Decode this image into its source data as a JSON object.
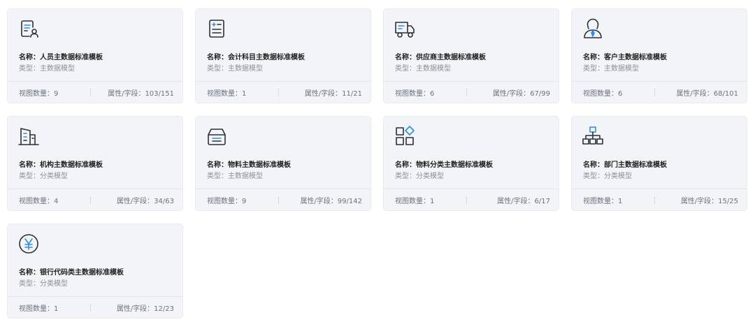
{
  "colors": {
    "icon_stroke": "#2b3036",
    "icon_accent": "#2d8cf0",
    "card_bg": "#f2f4f7"
  },
  "cards": [
    {
      "icon": "user-document-icon",
      "name": "名称：人员主数据标准模板",
      "type": "类型：主数据模型",
      "views": "视图数量：9",
      "fields": "属性/字段：103/151"
    },
    {
      "icon": "ledger-document-icon",
      "name": "名称：会计科目主数据标准模板",
      "type": "类型：主数据模型",
      "views": "视图数量：1",
      "fields": "属性/字段：11/21"
    },
    {
      "icon": "truck-icon",
      "name": "名称：供应商主数据标准模板",
      "type": "类型：主数据模型",
      "views": "视图数量：6",
      "fields": "属性/字段：67/99"
    },
    {
      "icon": "customer-icon",
      "name": "名称：客户主数据标准模板",
      "type": "类型：主数据模型",
      "views": "视图数量：6",
      "fields": "属性/字段：68/101"
    },
    {
      "icon": "building-icon",
      "name": "名称：机构主数据标准模板",
      "type": "类型：分类模型",
      "views": "视图数量：4",
      "fields": "属性/字段：34/63"
    },
    {
      "icon": "inbox-tray-icon",
      "name": "名称：物料主数据标准模板",
      "type": "类型：主数据模型",
      "views": "视图数量：9",
      "fields": "属性/字段：99/142"
    },
    {
      "icon": "category-shapes-icon",
      "name": "名称：物料分类主数据标准模板",
      "type": "类型：分类模型",
      "views": "视图数量：1",
      "fields": "属性/字段：6/17"
    },
    {
      "icon": "org-tree-icon",
      "name": "名称：部门主数据标准模板",
      "type": "类型：分类模型",
      "views": "视图数量：1",
      "fields": "属性/字段：15/25"
    },
    {
      "icon": "yen-coin-icon",
      "name": "名称：银行代码类主数据标准模板",
      "type": "类型：分类模型",
      "views": "视图数量：1",
      "fields": "属性/字段：12/23"
    }
  ]
}
